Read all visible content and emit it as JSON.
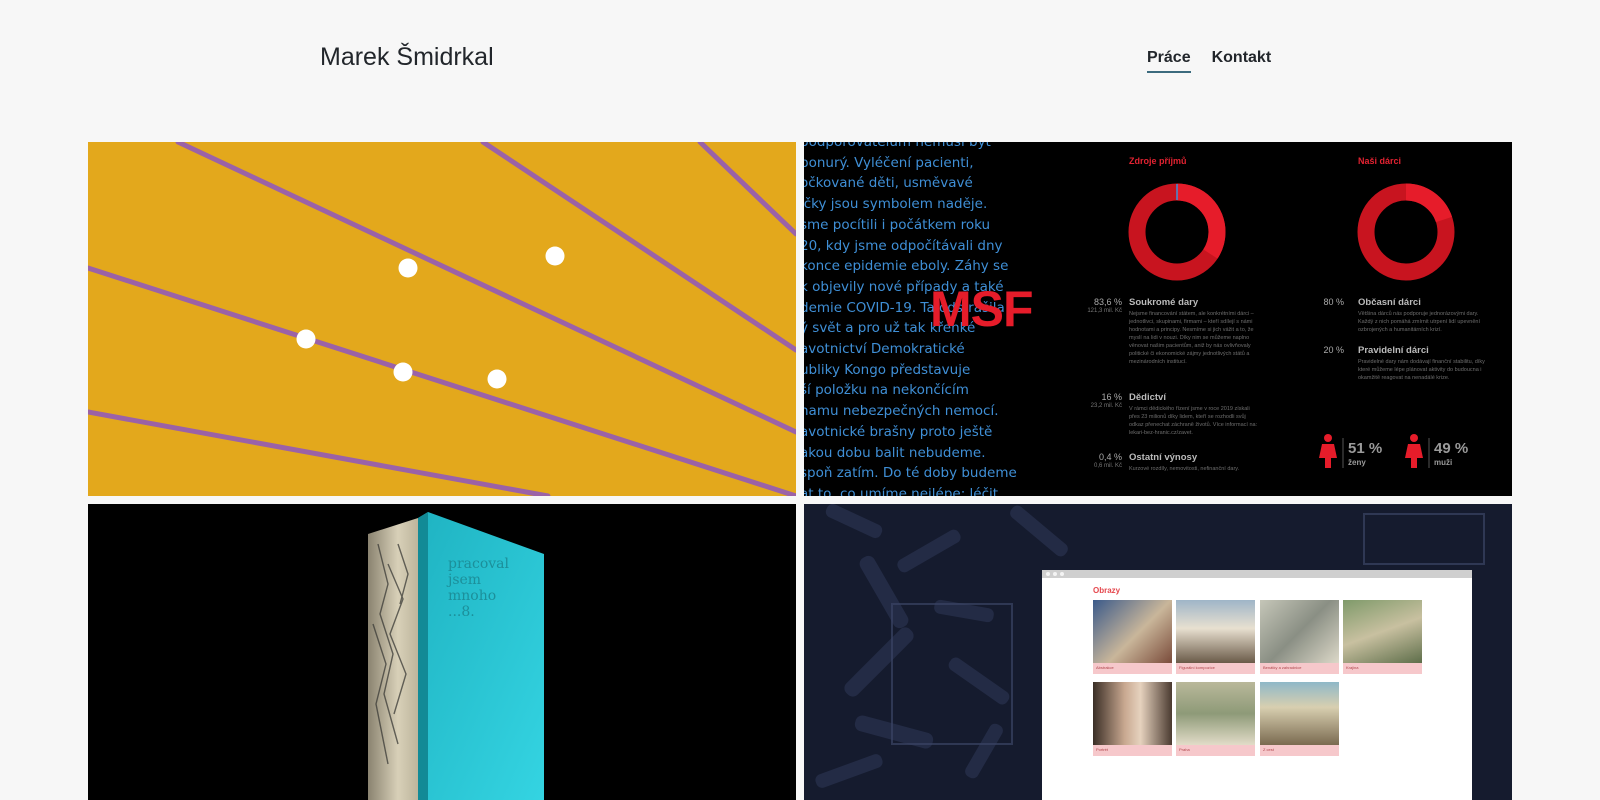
{
  "site": {
    "title": "Marek Šmidrkal"
  },
  "nav": {
    "items": [
      {
        "label": "Práce",
        "active": true
      },
      {
        "label": "Kontakt",
        "active": false
      }
    ]
  },
  "colors": {
    "yellow": "#e3a81c",
    "purple_line": "#9b62a7",
    "msf_red": "#e61c2a",
    "msf_blue": "#3f8fd6",
    "book_teal": "#2ec8d4",
    "gallery_pink": "#f6c8cb"
  },
  "msf": {
    "column_lines": [
      "podporovatelům nemusí být",
      "ponurý. Vyléčení pacienti,",
      "očkované děti, usměvavé",
      "ičky jsou symbolem naděje.",
      "sme pocítili i počátkem roku",
      "20, kdy jsme odpočítávali dny",
      "konce epidemie eboly. Záhy se",
      "k objevily nové případy a také",
      "demie COVID-19. Ta odstrašila",
      "ý svět a pro už tak křehké",
      "avotnictví Demokratické",
      "ubliky Kongo představuje",
      "ší položku na nekončícím",
      "namu nebezpečných nemocí.",
      "avotnické brašny proto ještě",
      "akou dobu balit nebudeme.",
      "spoň zatím. Do té doby budeme",
      "at to, co umíme nejlépe: léčit"
    ],
    "logo": "MSF",
    "income_heading": "Zdroje příjmů",
    "donors_heading": "Naši dárci",
    "income": [
      {
        "pct": "83,6 %",
        "sub": "121,3 mil. Kč",
        "title": "Soukromé dary",
        "desc": "Nejsme financování státem, ale konkrétními dárci – jednotlivci, skupinami, firmami – kteří sdílejí s námi hodnotami a principy. Nesmíme si jich vážit a to, že myslí na lidi v nouzi. Díky nim se můžeme naplno věnovat našim pacientům, aniž by nás ovlivňovaly politické či ekonomické zájmy jednotlivých států a mezinárodních institucí."
      },
      {
        "pct": "16 %",
        "sub": "23,2 mil. Kč",
        "title": "Dědictví",
        "desc": "V rámci dědického řízení jsme v roce 2019 získali přes 23 milionů díky lidem, kteří se rozhodli svůj odkaz přenechat záchraně životů. Více informací na: lekari-bez-hranic.cz/zavet."
      },
      {
        "pct": "0,4 %",
        "sub": "0,6 mil. Kč",
        "title": "Ostatní výnosy",
        "desc": "Kurzové rozdíly, nemovitosti, nefinanční dary."
      }
    ],
    "donors": [
      {
        "pct": "80 %",
        "title": "Občasní dárci",
        "desc": "Většina dárců nás podporuje jednorázovými dary. Každý z nich pomáhá zmírnit utrpení lidí upevnění ozbrojených a humanitárních krizí."
      },
      {
        "pct": "20 %",
        "title": "Pravidelní dárci",
        "desc": "Pravidelné dary nám dodávají finanční stabilitu, díky které můžeme lépe plánovat aktivity do budoucna i okamžitě reagovat na nenadálé krize."
      }
    ],
    "women": {
      "pct": "51 %",
      "label": "ženy"
    },
    "men": {
      "pct": "49 %",
      "label": "muži"
    }
  },
  "book": {
    "title_lines": [
      "pracoval",
      "jsem",
      "mnoho",
      "...8."
    ]
  },
  "gallery": {
    "title": "Obrazy",
    "cards": [
      "Abstrakce",
      "Figurální kompozice",
      "Benátky a zahradnice",
      "Krajina",
      "Portrét",
      "Praha",
      "Z cest"
    ]
  }
}
